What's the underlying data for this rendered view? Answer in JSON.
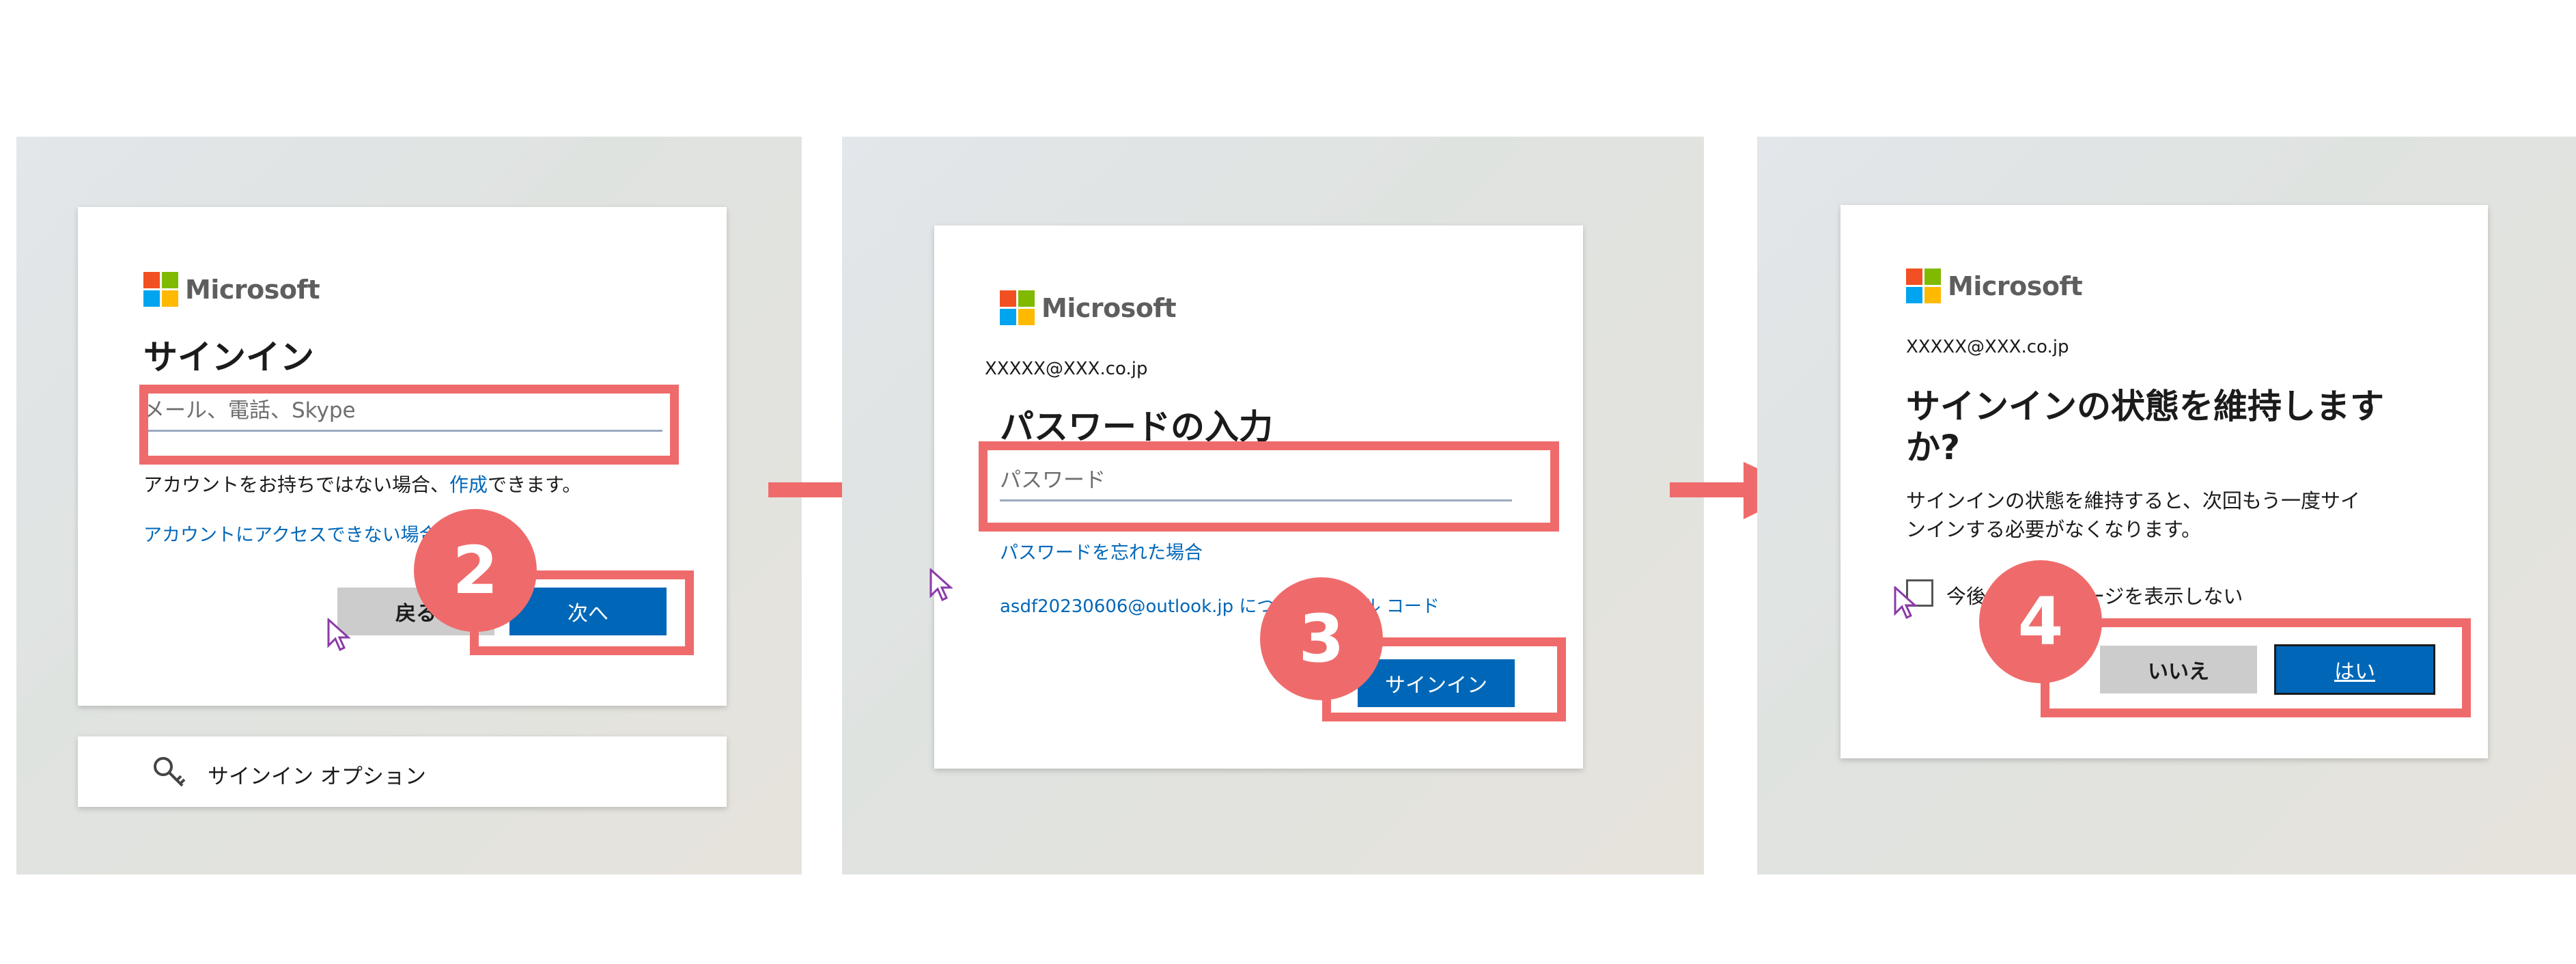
{
  "colors": {
    "highlight": "#ef6b6b",
    "primary_button": "#0067b8",
    "secondary_button": "#cccccc",
    "link": "#0067b8"
  },
  "step1": {
    "brand": "Microsoft",
    "title": "サインイン",
    "email_placeholder": "メール、電話、Skype",
    "no_account_prefix": "アカウントをお持ちではない場合、",
    "create_link": "作成",
    "no_account_suffix": "できます。",
    "cant_access_link": "アカウントにアクセスできない場合",
    "back_button": "戻る",
    "next_button": "次へ",
    "options_icon": "key-icon",
    "options_label": "サインイン オプション",
    "badge": "2"
  },
  "step2": {
    "brand": "Microsoft",
    "account": "XXXXX@XXX.co.jp",
    "title": "パスワードの入力",
    "password_placeholder": "パスワード",
    "forgot_link": "パスワードを忘れた場合",
    "email_code_link": "asdf20230606@outlook.jp についてのメール コード",
    "signin_button": "サインイン",
    "badge": "3"
  },
  "step3": {
    "brand": "Microsoft",
    "account": "XXXXX@XXX.co.jp",
    "title_line1": "サインインの状態を維持します",
    "title_line2": "か?",
    "description_line1": "サインインの状態を維持すると、次回もう一度サイ",
    "description_line2": "ンインする必要がなくなります。",
    "dont_show_label": "今後このメッセージを表示しない",
    "no_button": "いいえ",
    "yes_button": "はい",
    "badge": "4"
  },
  "arrows": [
    "arrow-right-icon",
    "arrow-right-icon"
  ]
}
